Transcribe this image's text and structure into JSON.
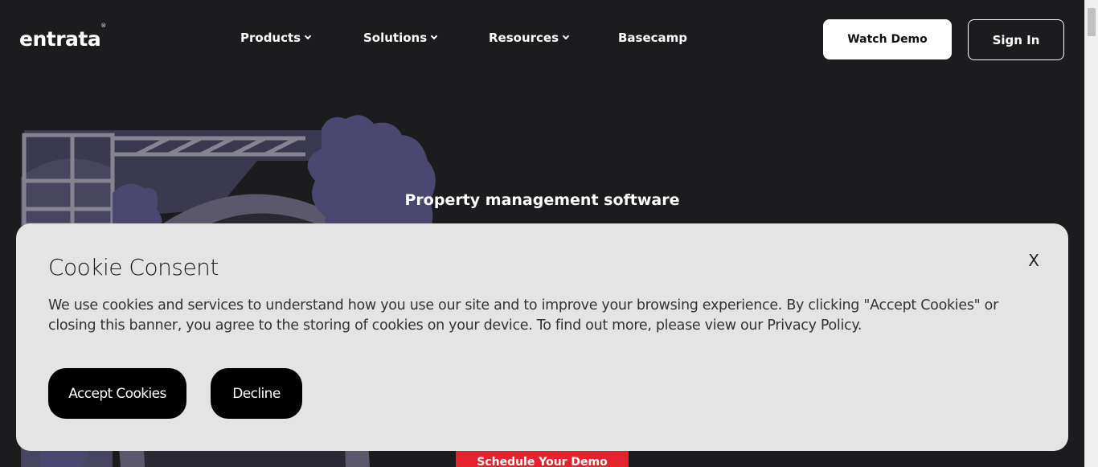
{
  "header": {
    "logo_text": "entrata",
    "logo_mark": "®",
    "nav": [
      {
        "label": "Products",
        "has_dropdown": true
      },
      {
        "label": "Solutions",
        "has_dropdown": true
      },
      {
        "label": "Resources",
        "has_dropdown": true
      },
      {
        "label": "Basecamp",
        "has_dropdown": false
      }
    ],
    "watch_demo_label": "Watch Demo",
    "sign_in_label": "Sign In"
  },
  "hero": {
    "subtitle": "Property management software",
    "cta_label": "Schedule Your Demo"
  },
  "cookie_banner": {
    "title": "Cookie Consent",
    "close_label": "X",
    "body": "We use cookies and services to understand how you use our site and to improve your browsing experience. By clicking \"Accept Cookies\" or closing this banner, you agree to the storing of cookies on your device. To find out more, please view our Privacy Policy.",
    "accept_label": "Accept Cookies",
    "decline_label": "Decline"
  },
  "colors": {
    "background": "#1c1b1d",
    "banner": "#e4e4e4",
    "cta_red": "#e4232c",
    "illustration_purple": "#3f3d5c"
  }
}
